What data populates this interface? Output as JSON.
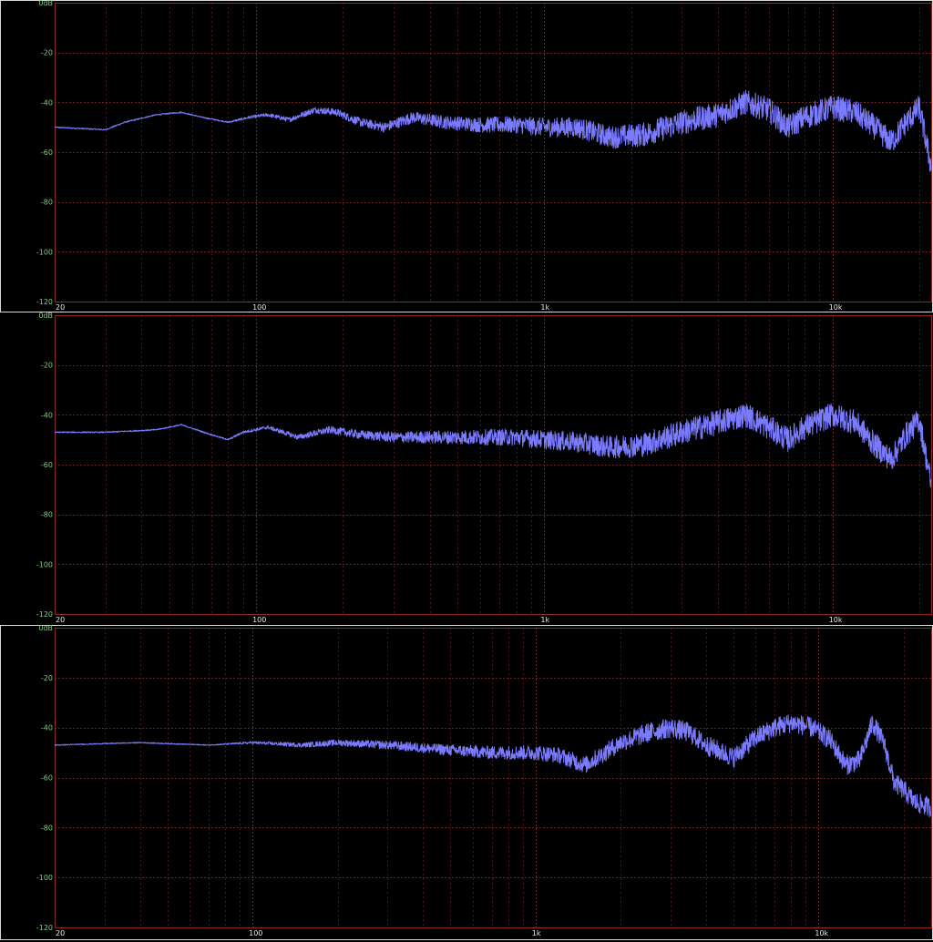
{
  "chart_data": [
    {
      "type": "line",
      "title": "",
      "xlabel": "",
      "ylabel": "",
      "x_scale": "log",
      "xlim": [
        20,
        22000
      ],
      "ylim": [
        -120,
        0
      ],
      "grid": true,
      "y_ticks": [
        "0dB",
        "-20",
        "-40",
        "-60",
        "-80",
        "-100",
        "-120"
      ],
      "x_ticks": [
        "20",
        "100",
        "1k",
        "10k"
      ],
      "noise": 5,
      "series": [
        {
          "color": "#7b7bff",
          "points": [
            [
              20,
              -50
            ],
            [
              30,
              -51
            ],
            [
              35,
              -48
            ],
            [
              45,
              -45
            ],
            [
              55,
              -44
            ],
            [
              65,
              -46
            ],
            [
              80,
              -48
            ],
            [
              95,
              -46
            ],
            [
              110,
              -45
            ],
            [
              130,
              -47
            ],
            [
              160,
              -43
            ],
            [
              190,
              -44
            ],
            [
              230,
              -48
            ],
            [
              280,
              -50
            ],
            [
              350,
              -46
            ],
            [
              450,
              -48
            ],
            [
              600,
              -49
            ],
            [
              800,
              -49
            ],
            [
              1000,
              -50
            ],
            [
              1300,
              -50
            ],
            [
              1700,
              -54
            ],
            [
              2200,
              -53
            ],
            [
              3000,
              -48
            ],
            [
              4000,
              -45
            ],
            [
              5000,
              -40
            ],
            [
              6000,
              -43
            ],
            [
              7000,
              -50
            ],
            [
              8000,
              -46
            ],
            [
              10000,
              -42
            ],
            [
              12000,
              -44
            ],
            [
              14000,
              -50
            ],
            [
              16000,
              -56
            ],
            [
              18000,
              -48
            ],
            [
              20000,
              -42
            ],
            [
              22000,
              -66
            ]
          ]
        }
      ]
    },
    {
      "type": "line",
      "title": "",
      "xlabel": "",
      "ylabel": "",
      "x_scale": "log",
      "xlim": [
        20,
        22000
      ],
      "ylim": [
        -120,
        0
      ],
      "grid": true,
      "y_ticks": [
        "0dB",
        "-20",
        "-40",
        "-60",
        "-80",
        "-100",
        "-120"
      ],
      "x_ticks": [
        "20",
        "100",
        "1k",
        "10k"
      ],
      "noise": 5,
      "series": [
        {
          "color": "#7b7bff",
          "points": [
            [
              20,
              -47
            ],
            [
              30,
              -47
            ],
            [
              45,
              -46
            ],
            [
              55,
              -44
            ],
            [
              70,
              -48
            ],
            [
              80,
              -50
            ],
            [
              90,
              -47
            ],
            [
              110,
              -45
            ],
            [
              140,
              -49
            ],
            [
              180,
              -46
            ],
            [
              230,
              -48
            ],
            [
              300,
              -49
            ],
            [
              400,
              -49
            ],
            [
              600,
              -49
            ],
            [
              800,
              -49
            ],
            [
              1000,
              -50
            ],
            [
              1300,
              -51
            ],
            [
              1700,
              -53
            ],
            [
              2200,
              -52
            ],
            [
              3000,
              -47
            ],
            [
              4000,
              -43
            ],
            [
              5000,
              -40
            ],
            [
              6000,
              -45
            ],
            [
              7000,
              -50
            ],
            [
              8000,
              -45
            ],
            [
              10000,
              -40
            ],
            [
              12000,
              -43
            ],
            [
              14000,
              -52
            ],
            [
              16000,
              -58
            ],
            [
              18000,
              -48
            ],
            [
              20000,
              -42
            ],
            [
              22000,
              -68
            ]
          ]
        }
      ]
    },
    {
      "type": "line",
      "title": "",
      "xlabel": "",
      "ylabel": "",
      "x_scale": "log",
      "xlim": [
        20,
        25000
      ],
      "ylim": [
        -120,
        0
      ],
      "grid": true,
      "y_ticks": [
        "0dB",
        "-20",
        "-40",
        "-60",
        "-80",
        "-100",
        "-120"
      ],
      "x_ticks": [
        "20",
        "100",
        "1k",
        "10k"
      ],
      "noise": 4,
      "series": [
        {
          "color": "#7b7bff",
          "points": [
            [
              20,
              -47
            ],
            [
              40,
              -46
            ],
            [
              70,
              -47
            ],
            [
              100,
              -46
            ],
            [
              150,
              -47
            ],
            [
              200,
              -46
            ],
            [
              300,
              -47
            ],
            [
              500,
              -49
            ],
            [
              700,
              -50
            ],
            [
              1000,
              -50
            ],
            [
              1200,
              -51
            ],
            [
              1500,
              -55
            ],
            [
              2000,
              -46
            ],
            [
              2500,
              -42
            ],
            [
              3000,
              -40
            ],
            [
              3500,
              -42
            ],
            [
              4000,
              -47
            ],
            [
              5000,
              -52
            ],
            [
              6000,
              -44
            ],
            [
              7000,
              -40
            ],
            [
              8000,
              -38
            ],
            [
              9500,
              -40
            ],
            [
              11000,
              -45
            ],
            [
              12500,
              -55
            ],
            [
              14000,
              -53
            ],
            [
              15500,
              -38
            ],
            [
              17000,
              -46
            ],
            [
              18500,
              -62
            ],
            [
              20000,
              -65
            ],
            [
              22000,
              -70
            ],
            [
              25000,
              -72
            ]
          ]
        }
      ]
    }
  ]
}
